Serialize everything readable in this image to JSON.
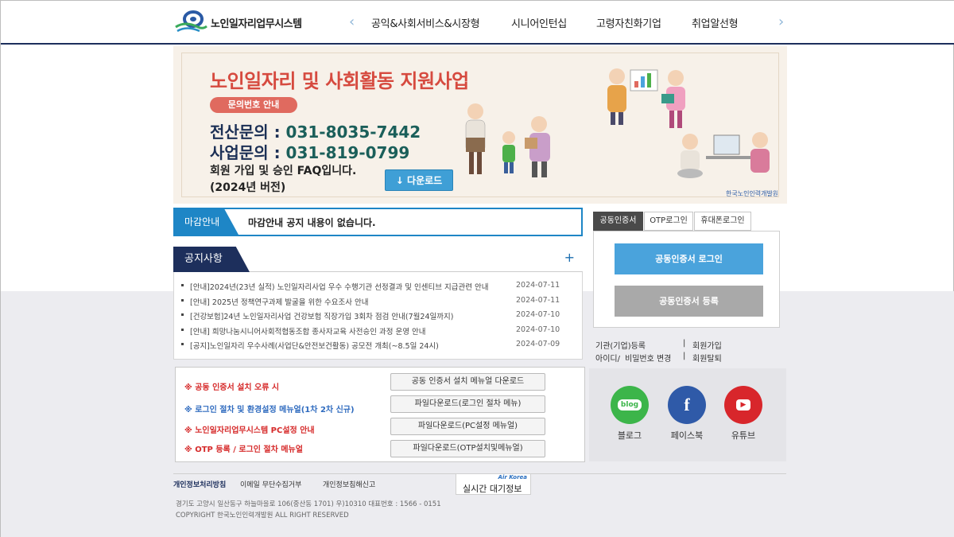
{
  "header": {
    "logo_text": "노인일자리업무시스템",
    "nav_items": [
      "공익&사회서비스&시장형",
      "시니어인턴십",
      "고령자친화기업",
      "취업알선형"
    ],
    "prev_arrow": "‹",
    "next_arrow": "›"
  },
  "banner": {
    "title": "노인일자리 및 사회활동 지원사업",
    "pill": "문의번호 안내",
    "phone1_label": "전산문의 : ",
    "phone1_number": "031-8035-7442",
    "phone2_label": "사업문의 : ",
    "phone2_number": "031-819-0799",
    "faq_line1": "회원 가입 및 승인 FAQ입니다.",
    "faq_line2": "(2024년 버전)",
    "download_label": "↓ 다운로드"
  },
  "deadline": {
    "label": "마감안내",
    "text": "마감안내 공지 내용이 없습니다."
  },
  "notices": {
    "title": "공지사항",
    "more": "+",
    "items": [
      {
        "title": "[안내]2024년(23년 실적) 노인일자리사업 우수 수행기관 선정결과 및 인센티브 지급관련 안내",
        "date": "2024-07-11"
      },
      {
        "title": "[안내] 2025년 정책연구과제 발굴을 위한 수요조사 안내",
        "date": "2024-07-11"
      },
      {
        "title": "[건강보험]24년 노인일자리사업 건강보험 직장가입 3회차 점검 안내(7월24일까지)",
        "date": "2024-07-10"
      },
      {
        "title": "[안내] 희망나눔시니어사회적협동조합 종사자교육 사전승인 과정 운영 안내",
        "date": "2024-07-10"
      },
      {
        "title": "[공지]노인일자리 우수사례(사업단&안전보건활동) 공모전 개최(~8.5일 24시)",
        "date": "2024-07-09"
      }
    ]
  },
  "help": {
    "links": [
      {
        "text": "※ 공동 인증서 설치 오류 시",
        "color": "#d62a2a"
      },
      {
        "text": "※ 로그인 절차 및 환경설정 메뉴얼(1차 2차 신규)",
        "color": "#2f6bbf"
      },
      {
        "text": "※ 노인일자리업무시스템 PC설정 안내",
        "color": "#d62a2a"
      },
      {
        "text": "※ OTP 등록 / 로그인 절차 메뉴얼",
        "color": "#d62a2a"
      }
    ],
    "buttons": [
      "공동 인증서 설치 메뉴얼 다운로드",
      "파일다운로드(로그인 절차 메뉴)",
      "파일다운로드(PC설정 메뉴얼)",
      "파일다운로드(OTP설치및메뉴얼)"
    ]
  },
  "login": {
    "tabs": [
      "공동인증서",
      "OTP로그인",
      "휴대폰로그인"
    ],
    "login_button": "공동인증서 로그인",
    "register_button": "공동인증서 등록",
    "login_button_color": "#4aa3dc",
    "register_button_color": "#a9a9a9",
    "link_org_register": "기관(기업)등록",
    "link_member_join": "회원가입",
    "link_id": "아이디/",
    "link_pw": "비밀번호 변경",
    "link_withdraw": "회원탈퇴",
    "sep": "|"
  },
  "social": [
    {
      "label": "블로그",
      "icon": "blog-icon",
      "glyph": "blog",
      "color": "#3cb54a"
    },
    {
      "label": "페이스북",
      "icon": "facebook-icon",
      "glyph": "f",
      "color": "#2f5aa8"
    },
    {
      "label": "유튜브",
      "icon": "youtube-icon",
      "glyph": "▶",
      "color": "#d8262b"
    }
  ],
  "footer": {
    "links": [
      "개인정보처리방침",
      "이메일 무단수집거부",
      "개인정보침해신고"
    ],
    "air_title": "실시간 대기정보",
    "air_logo": "Air Korea",
    "address": "경기도 고양시 일산동구 하늘마을로 106(중산동 1701) 우)10310    대표번호 : 1566 - 0151",
    "copyright": "COPYRIGHT 한국노인인력개발원 ALL RIGHT RESERVED"
  }
}
